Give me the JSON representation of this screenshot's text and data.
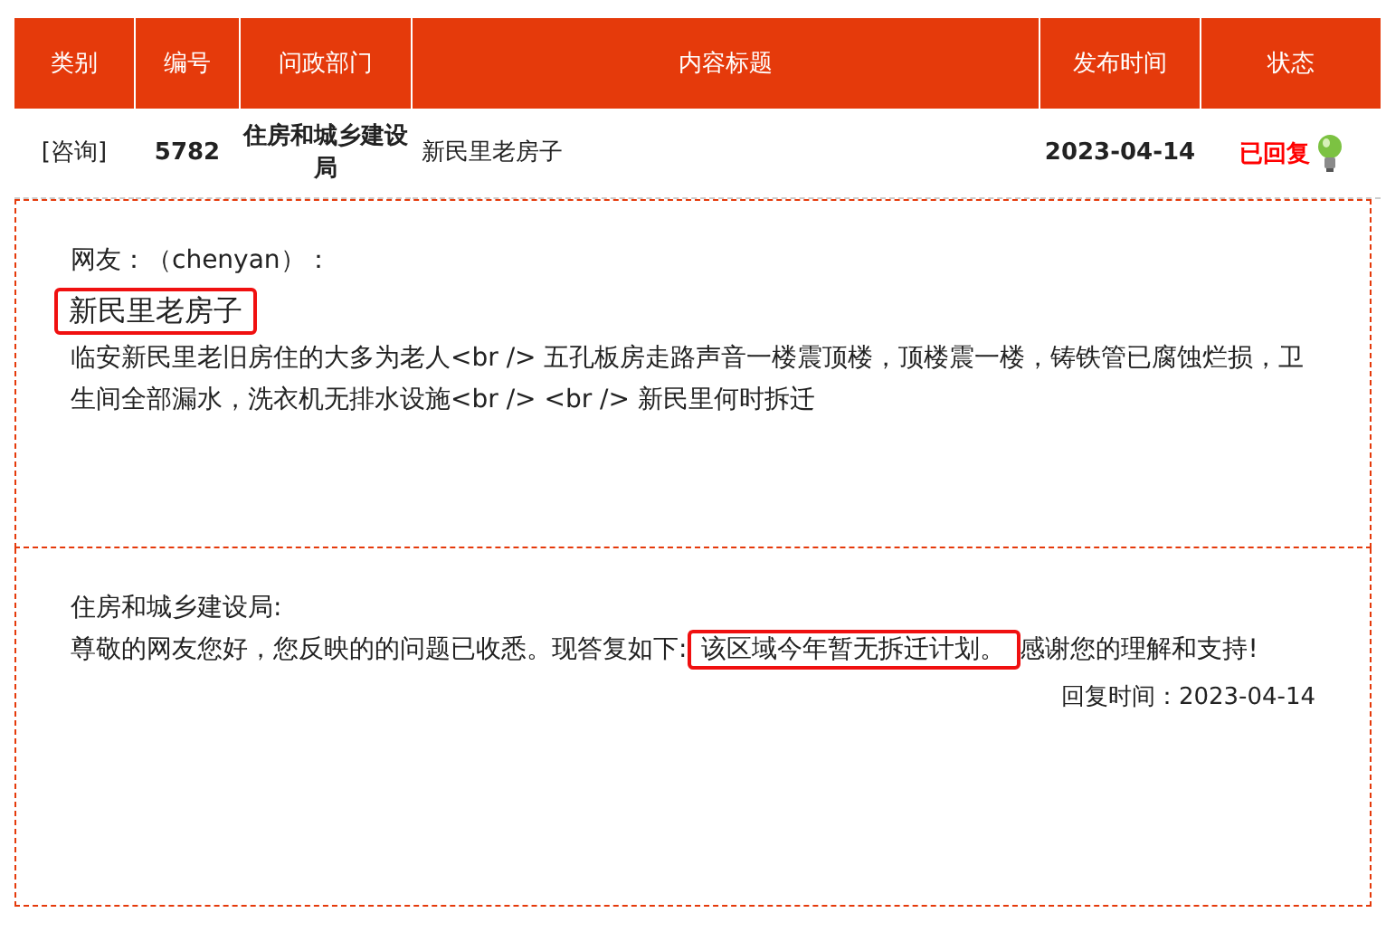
{
  "table": {
    "columns": [
      "类别",
      "编号",
      "问政部门",
      "内容标题",
      "发布时间",
      "状态"
    ],
    "rows": [
      {
        "category": "[咨询]",
        "number": "5782",
        "department": "住房和城乡建设局",
        "title": "新民里老房子",
        "date": "2023-04-14",
        "status": "已回复",
        "replied": true
      }
    ]
  },
  "question": {
    "author": "网友：（chenyan）：",
    "title": "新民里老房子",
    "title_highlighted": true,
    "body": "临安新民里老旧房住的大多为老人<br /> 五孔板房走路声音一楼震顶楼，顶楼震一楼，铸铁管已腐蚀烂损，卫生间全部漏水，洗衣机无排水设施<br /> <br /> 新民里何时拆迁"
  },
  "reply": {
    "department": "住房和城乡建设局:",
    "segments": [
      {
        "text": "尊敬的网友您好，您反映的的问题已收悉。现答复如下:",
        "highlighted": false
      },
      {
        "text": "该区域今年暂无拆迁计划。",
        "highlighted": true
      },
      {
        "text": "感谢您的理解和支持!",
        "highlighted": false
      }
    ],
    "time": "回复时间：2023-04-14"
  }
}
